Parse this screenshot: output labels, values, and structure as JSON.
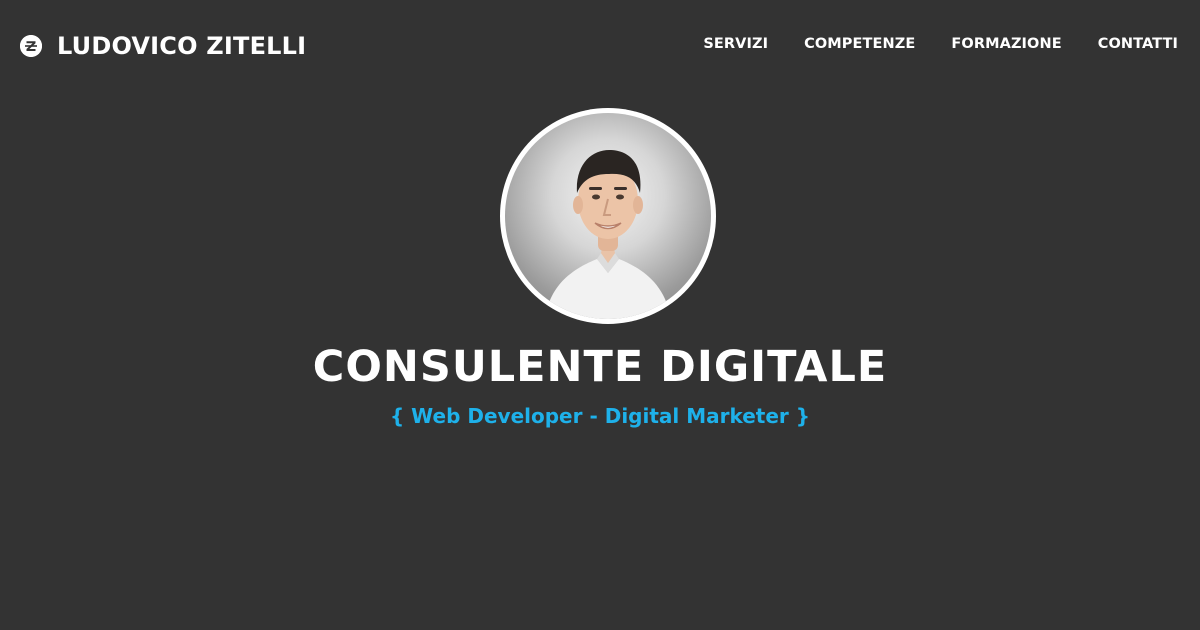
{
  "header": {
    "brand_name": "LUDOVICO ZITELLI",
    "logo_letter": "Z",
    "nav": [
      {
        "label": "SERVIZI"
      },
      {
        "label": "COMPETENZE"
      },
      {
        "label": "FORMAZIONE"
      },
      {
        "label": "CONTATTI"
      }
    ]
  },
  "hero": {
    "title": "CONSULENTE DIGITALE",
    "subtitle": "{ Web Developer - Digital Marketer }"
  },
  "colors": {
    "background": "#333333",
    "text": "#ffffff",
    "accent": "#1eb1ea"
  },
  "icons": {
    "logo": "z-circle-logo-icon",
    "avatar": "profile-photo"
  }
}
